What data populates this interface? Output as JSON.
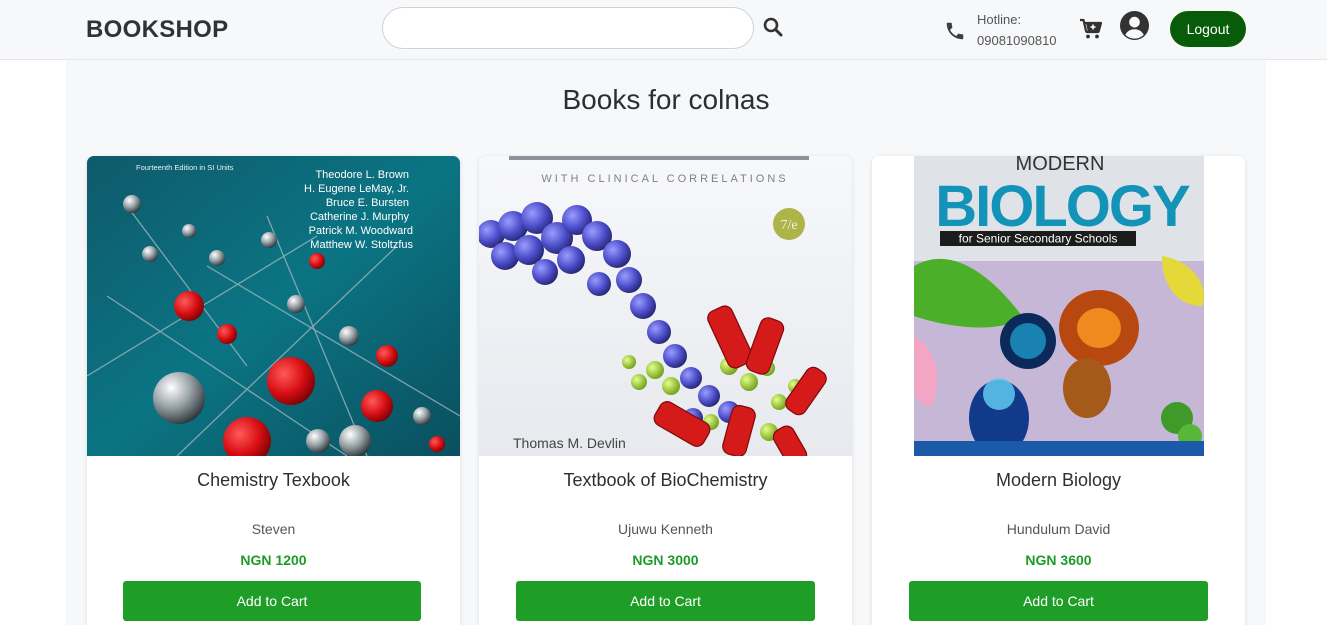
{
  "navbar": {
    "brand": "BOOKSHOP",
    "search": {
      "value": "",
      "placeholder": ""
    },
    "hotline_label": "Hotline:",
    "hotline_number": "09081090810",
    "logout_label": "Logout",
    "icons": {
      "search": "search-icon",
      "phone": "phone-icon",
      "cart": "cart-icon",
      "user": "user-icon"
    }
  },
  "page": {
    "title": "Books for colnas"
  },
  "books": [
    {
      "title": "Chemistry Texbook",
      "author": "Steven",
      "price": "NGN 1200",
      "button": "Add to Cart",
      "cover": {
        "edition_text": "Fourteenth Edition in SI Units",
        "authors_text": [
          "Theodore L. Brown",
          "H. Eugene LeMay, Jr.",
          "Bruce E. Bursten",
          "Catherine J. Murphy",
          "Patrick M. Woodward",
          "Matthew W. Stoltzfus"
        ]
      }
    },
    {
      "title": "Textbook of BioChemistry",
      "author": "Ujuwu Kenneth",
      "price": "NGN 3000",
      "button": "Add to Cart",
      "cover": {
        "subtitle_text": "WITH CLINICAL CORRELATIONS",
        "edition_text": "7/e",
        "author_text": "Thomas M. Devlin"
      }
    },
    {
      "title": "Modern Biology",
      "author": "Hundulum David",
      "price": "NGN 3600",
      "button": "Add to Cart",
      "cover": {
        "top_text": "MODERN",
        "big_text": "BIOLOGY",
        "band_text": "for Senior Secondary Schools"
      }
    }
  ],
  "colors": {
    "navbar_bg": "#f7f8fa",
    "logout_bg": "#075c0a",
    "add_button_bg": "#1f9e27",
    "price_color": "#1e9a28"
  }
}
